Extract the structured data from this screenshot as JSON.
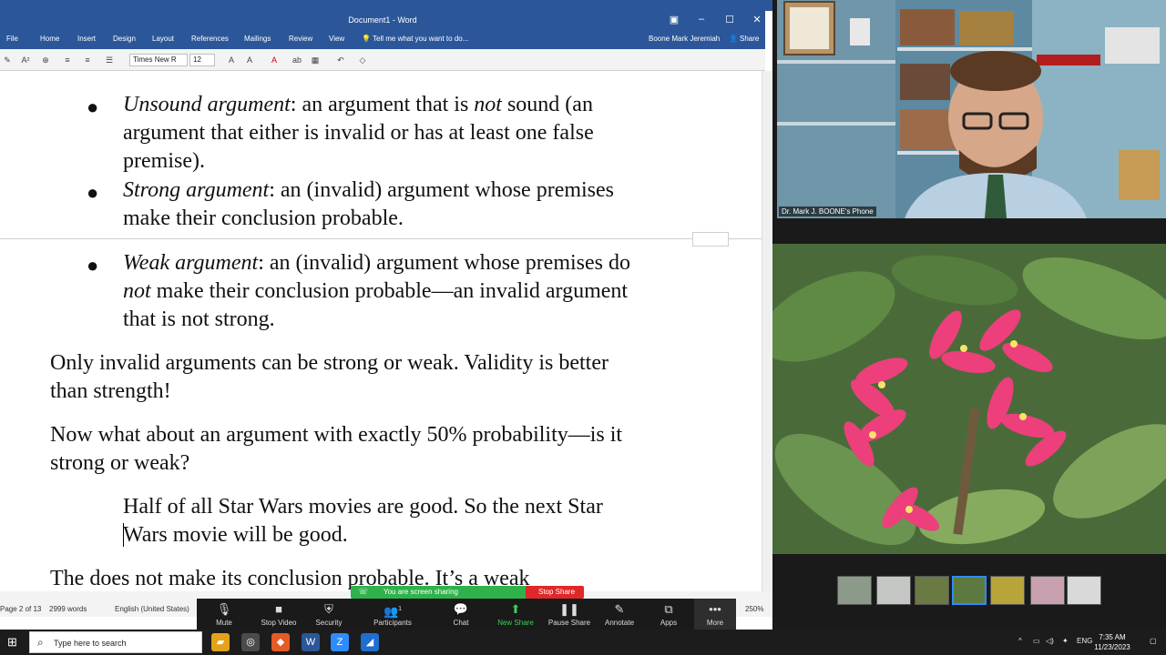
{
  "word": {
    "title": "Document1 - Word",
    "tabs": [
      "File",
      "Home",
      "Insert",
      "Design",
      "Layout",
      "References",
      "Mailings",
      "Review",
      "View"
    ],
    "tell_me": "Tell me what you want to do...",
    "user": "Boone Mark Jeremiah",
    "share": "Share",
    "font_name": "Times New R",
    "font_size": "12",
    "status": {
      "page": "Page 2 of 13",
      "words": "2999 words",
      "language": "English (United States)",
      "zoom": "250%"
    }
  },
  "doc": {
    "b1_term": "Unsound argument",
    "b1_a": ": an argument that is ",
    "b1_not": "not",
    "b1_b": " sound (an",
    "b1_l2": "argument that either is invalid or has at least one false",
    "b1_l3": "premise).",
    "b2_term": "Strong argument",
    "b2_a": ": an (invalid) argument whose premises",
    "b2_l2": "make their conclusion probable.",
    "b3_term": "Weak argument",
    "b3_a": ": an (invalid) argument whose premises do",
    "b3_not": "not",
    "b3_b": " make their conclusion probable—an invalid argument",
    "b3_l3": "that is not strong.",
    "p1_l1": "Only invalid arguments can be strong or weak. Validity is better",
    "p1_l2": "than strength!",
    "p2_l1": "Now what about an argument with exactly 50% probability—is it",
    "p2_l2": "strong or weak?",
    "ex_l1": "Half of all Star Wars movies are good. So the next Star",
    "ex_l2": "Wars movie will be good.",
    "p3_l1": "The does not make its conclusion probable. It’s a weak"
  },
  "zoom": {
    "banner": "You are screen sharing",
    "stop_share": "Stop Share",
    "buttons": {
      "mute": "Mute",
      "stop_video": "Stop Video",
      "security": "Security",
      "participants": "Participants",
      "participants_count": "1",
      "chat": "Chat",
      "new_share": "New Share",
      "pause_share": "Pause Share",
      "annotate": "Annotate",
      "apps": "Apps",
      "more": "More"
    },
    "video_label": "Dr. Mark J. BOONE's Phone"
  },
  "taskbar": {
    "search_placeholder": "Type here to search",
    "language": "ENG",
    "time": "7:35 AM",
    "date": "11/23/2023"
  },
  "colors": {
    "word_blue": "#2b579a",
    "zoom_green": "#2fb24c",
    "stop_red": "#e02828",
    "selected_thumb": "#2d8cff"
  }
}
